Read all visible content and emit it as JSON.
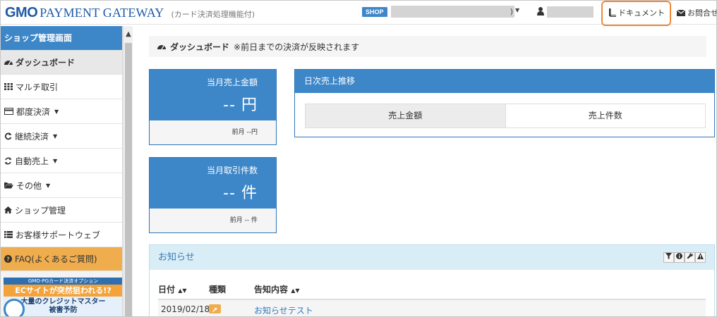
{
  "header": {
    "logo_gmo": "GMO",
    "logo_rest": "PAYMENT GATEWAY",
    "logo_sub": "(カード決済処理機能付)",
    "shop_badge": "SHOP",
    "shop_select_suffix": ")",
    "document_link": "ドキュメント",
    "contact_link": "お問合せ"
  },
  "sidebar": {
    "title": "ショップ管理画面",
    "items": [
      {
        "label": "ダッシュボード",
        "icon": "dashboard-icon"
      },
      {
        "label": "マルチ取引",
        "icon": "grid-icon"
      },
      {
        "label": "都度決済",
        "icon": "credit-card-icon"
      },
      {
        "label": "継続決済",
        "icon": "repeat-icon"
      },
      {
        "label": "自動売上",
        "icon": "refresh-icon"
      },
      {
        "label": "その他",
        "icon": "folder-icon"
      },
      {
        "label": "ショップ管理",
        "icon": "home-icon"
      },
      {
        "label": "お客様サポートウェブ",
        "icon": "list-icon"
      },
      {
        "label": "FAQ(よくあるご質問)",
        "icon": "question-icon"
      }
    ],
    "banner": {
      "top": "GMO-PGカード決済オプション",
      "mid": "ECサイトが突然狙われる!?",
      "bot1": "大量のクレジットマスター",
      "bot2": "被害予防"
    }
  },
  "breadcrumb": {
    "title": "ダッシュボード",
    "note": "※前日までの決済が反映されます"
  },
  "stats": {
    "monthly_sales": {
      "label": "当月売上金額",
      "value": "-- 円",
      "prev": "前月 --円"
    },
    "monthly_count": {
      "label": "当月取引件数",
      "value": "-- 件",
      "prev": "前月 -- 件"
    }
  },
  "daily_chart": {
    "title": "日次売上推移",
    "tabs": [
      "売上金額",
      "売上件数"
    ]
  },
  "news": {
    "title": "お知らせ",
    "columns": [
      "日付",
      "種類",
      "告知内容"
    ],
    "rows": [
      {
        "date": "2019/02/18",
        "type_icon": "wrench-icon",
        "content": "お知らせテスト"
      }
    ]
  },
  "colors": {
    "accent": "#3d87c9",
    "highlight": "#f08a3c",
    "faq": "#f0ad4e"
  }
}
